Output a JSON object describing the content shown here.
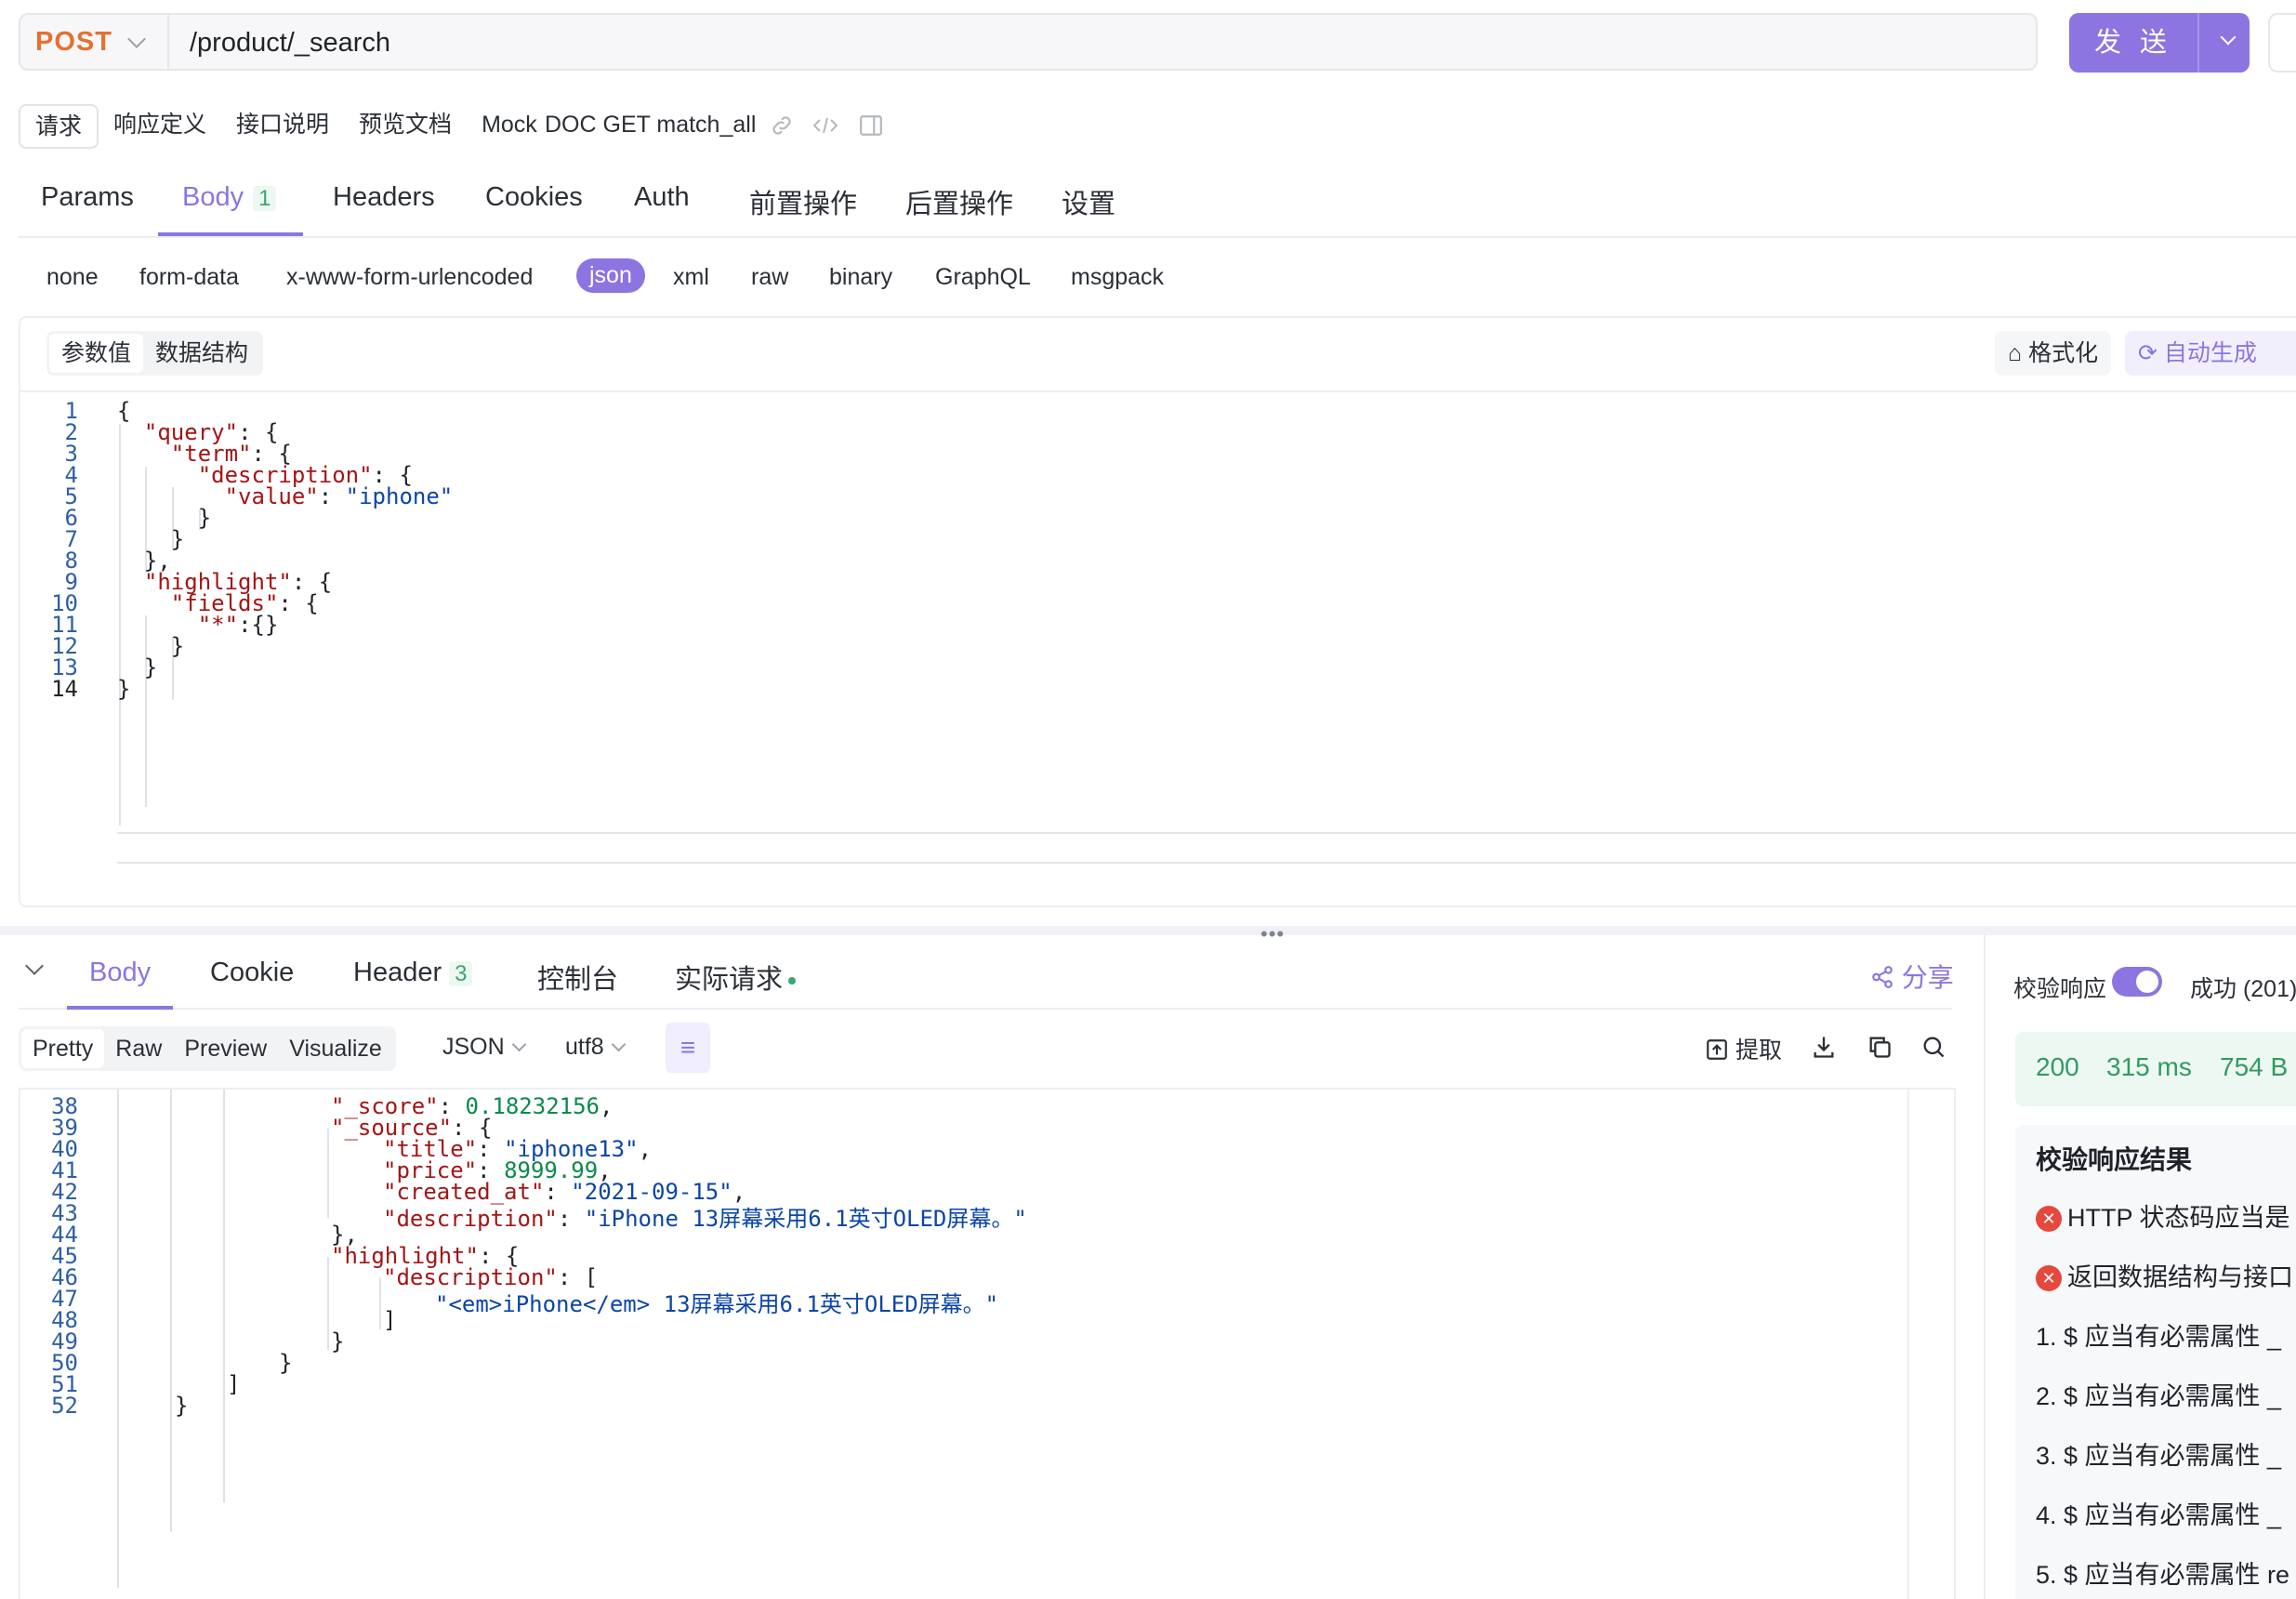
{
  "request": {
    "method": "POST",
    "url": "/product/_search",
    "send_label": "发 送"
  },
  "doc_tabs": [
    "请求",
    "响应定义",
    "接口说明",
    "预览文档",
    "Mock"
  ],
  "doc_title": "DOC GET match_all",
  "request_tabs": {
    "params": "Params",
    "body": "Body",
    "body_count": "1",
    "headers": "Headers",
    "cookies": "Cookies",
    "auth": "Auth",
    "pre": "前置操作",
    "post": "后置操作",
    "settings": "设置"
  },
  "body_types": [
    "none",
    "form-data",
    "x-www-form-urlencoded",
    "json",
    "xml",
    "raw",
    "binary",
    "GraphQL",
    "msgpack"
  ],
  "editor": {
    "seg_values": "参数值",
    "seg_schema": "数据结构",
    "format_label": "格式化",
    "autogen_label": "自动生成",
    "lines": [
      "1",
      "2",
      "3",
      "4",
      "5",
      "6",
      "7",
      "8",
      "9",
      "10",
      "11",
      "12",
      "13",
      "14"
    ]
  },
  "response": {
    "tabs": {
      "body": "Body",
      "cookie": "Cookie",
      "header": "Header",
      "header_count": "3",
      "console": "控制台",
      "actual": "实际请求"
    },
    "share_label": "分享",
    "view_modes": [
      "Pretty",
      "Raw",
      "Preview",
      "Visualize"
    ],
    "format": "JSON",
    "encoding": "utf8",
    "extract_label": "提取",
    "lines": [
      "38",
      "39",
      "40",
      "41",
      "42",
      "43",
      "44",
      "45",
      "46",
      "47",
      "48",
      "49",
      "50",
      "51",
      "52"
    ]
  },
  "validation": {
    "label": "校验响应",
    "status_text": "成功 (201)",
    "status_code": "200",
    "time": "315 ms",
    "size": "754 B",
    "result_title": "校验响应结果",
    "errors": [
      "HTTP 状态码应当是",
      "返回数据结构与接口"
    ],
    "items": [
      "1. $ 应当有必需属性 _",
      "2. $ 应当有必需属性 _",
      "3. $ 应当有必需属性 _",
      "4. $ 应当有必需属性 _",
      "5. $ 应当有必需属性 re"
    ]
  },
  "colors": {
    "accent": "#8c75e0",
    "method": "#e5702f",
    "success": "#2f9c63",
    "error": "#e5483c",
    "json_key": "#a31515",
    "json_string": "#0b45a8",
    "json_number": "#0a8a4a"
  },
  "icons": [
    "chevron-down-icon",
    "link-icon",
    "code-icon",
    "sidebar-icon",
    "format-icon",
    "refresh-icon",
    "share-icon",
    "wrap-icon",
    "extract-icon",
    "download-icon",
    "copy-icon",
    "search-icon",
    "error-icon"
  ]
}
